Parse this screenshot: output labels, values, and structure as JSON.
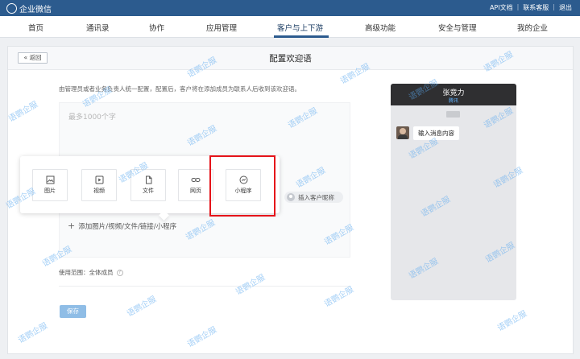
{
  "topbar": {
    "app_name": "企业微信",
    "links": [
      "API文档",
      "联系客服",
      "退出"
    ]
  },
  "nav": {
    "items": [
      "首页",
      "通讯录",
      "协作",
      "应用管理",
      "客户与上下游",
      "高级功能",
      "安全与管理",
      "我的企业"
    ],
    "active_index": 4
  },
  "page": {
    "back_label": "« 返回",
    "title": "配置欢迎语",
    "description": "由管理员或者业务负责人统一配置，配置后，客户将在添加成员为联系人后收到该欢迎语。",
    "placeholder": "最多1000个字",
    "attachments": [
      {
        "label": "图片",
        "icon": "image-icon"
      },
      {
        "label": "视频",
        "icon": "video-icon"
      },
      {
        "label": "文件",
        "icon": "file-icon"
      },
      {
        "label": "网页",
        "icon": "link-icon"
      },
      {
        "label": "小程序",
        "icon": "miniprogram-icon"
      }
    ],
    "insert_nickname": "插入客户昵称",
    "add_attachment": "添加图片/视频/文件/链接/小程序",
    "scope_label": "使用范围：全体成员",
    "save_label": "保存"
  },
  "preview": {
    "name": "张竞力",
    "corp": "腾讯",
    "message": "输入消息内容"
  },
  "watermark": "语鹦企服",
  "colors": {
    "topbar": "#2c5b8e",
    "highlight": "#e5141a",
    "save_button": "#8fbde6",
    "watermark": "#5aa9f0"
  }
}
